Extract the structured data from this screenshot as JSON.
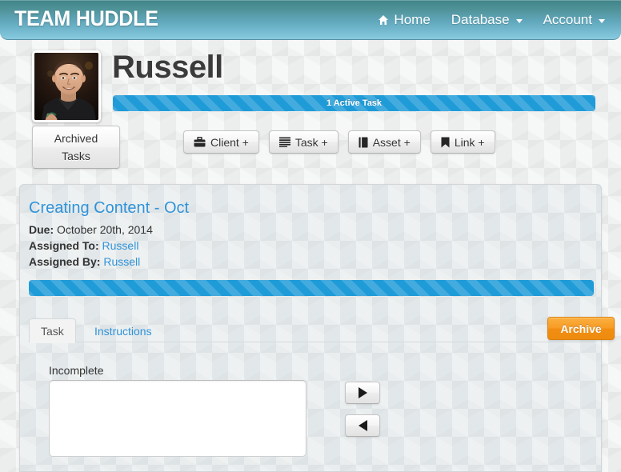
{
  "header": {
    "brand": "TEAM HUDDLE",
    "nav": [
      {
        "label": "Home",
        "icon": "home-icon",
        "caret": false
      },
      {
        "label": "Database",
        "icon": null,
        "caret": true
      },
      {
        "label": "Account",
        "icon": null,
        "caret": true
      }
    ]
  },
  "profile": {
    "avatar_alt": "user-photo",
    "username": "Russell",
    "active_tasks_label": "1 Active Task",
    "active_tasks_percent": 100,
    "archived_tasks_line1": "Archived",
    "archived_tasks_line2": "Tasks"
  },
  "actions": [
    {
      "label": "Client +",
      "icon": "briefcase-icon"
    },
    {
      "label": "Task +",
      "icon": "list-icon"
    },
    {
      "label": "Asset +",
      "icon": "book-icon"
    },
    {
      "label": "Link +",
      "icon": "bookmark-icon"
    }
  ],
  "task_card": {
    "title": "Creating Content - Oct",
    "due_label": "Due:",
    "due_value": "October 20th, 2014",
    "assigned_to_label": "Assigned To:",
    "assigned_to_value": "Russell",
    "assigned_by_label": "Assigned By:",
    "assigned_by_value": "Russell",
    "progress_percent": 100,
    "tabs": [
      {
        "label": "Task",
        "active": true
      },
      {
        "label": "Instructions",
        "active": false
      }
    ],
    "archive_button": "Archive",
    "incomplete_label": "Incomplete",
    "incomplete_value": "",
    "incomplete_placeholder": "",
    "move_right_icon": "triangle-right-icon",
    "move_left_icon": "triangle-left-icon"
  },
  "colors": {
    "brand_teal_top": "#3f8489",
    "brand_blue_bottom": "#8ecbdd",
    "accent_blue": "#2f93d8",
    "progress_blue": "#1f9bd8",
    "archive_orange": "#f79a24",
    "card_bg": "#e2e7ea",
    "page_bg": "#eceded"
  }
}
